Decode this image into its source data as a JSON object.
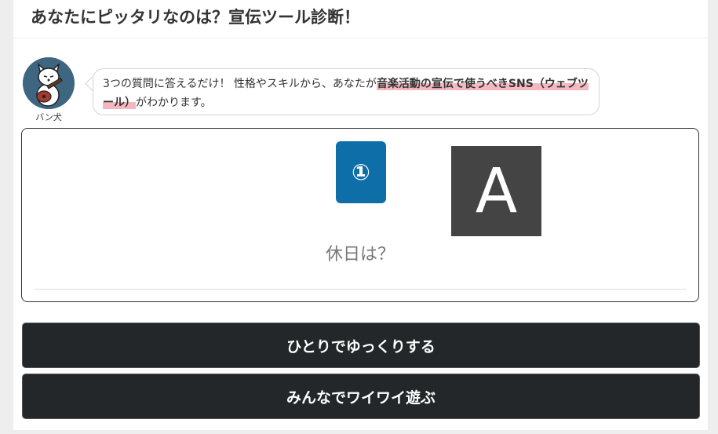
{
  "header": {
    "title": "あなたにピッタリなのは？宣伝ツール診断！"
  },
  "speaker": {
    "name": "バン犬",
    "message_plain": "3つの質問に答えるだけ！ 性格やスキルから、あなたが",
    "message_highlight": "音楽活動の宣伝で使うべきSNS（ウェブツール）",
    "message_end": "がわかります。"
  },
  "quiz": {
    "number_badge": "①",
    "image_letter": "A",
    "question": "休日は？",
    "answers": [
      {
        "label": "ひとりでゆっくりする"
      },
      {
        "label": "みんなでワイワイ遊ぶ"
      }
    ]
  },
  "colors": {
    "badge": "#0e6fa8",
    "button_bg": "#23272a",
    "highlight": "#f5b8c0",
    "avatar_bg": "#3f6680"
  }
}
